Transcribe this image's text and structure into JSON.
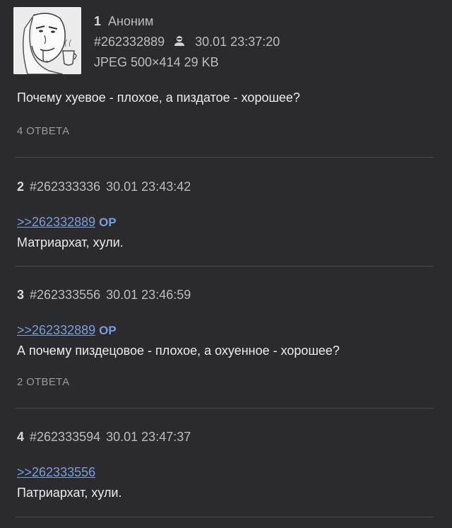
{
  "op": {
    "number": "1",
    "name": "Аноним",
    "post_id": "#262332889",
    "datetime": "30.01 23:37:20",
    "file_info": "JPEG 500×414 29 KB",
    "comment": "Почему хуевое - плохое, а пиздатое - хорошее?",
    "replies": "4 ОТВЕТА"
  },
  "posts": [
    {
      "number": "2",
      "post_id": "#262333336",
      "datetime": "30.01 23:43:42",
      "reply_link": ">>262332889",
      "op_tag": "OP",
      "comment": "Матриархат, хули.",
      "replies": ""
    },
    {
      "number": "3",
      "post_id": "#262333556",
      "datetime": "30.01 23:46:59",
      "reply_link": ">>262332889",
      "op_tag": "OP",
      "comment": "А почему пиздецовое - плохое, а охуенное - хорошее?",
      "replies": "2 ОТВЕТА"
    },
    {
      "number": "4",
      "post_id": "#262333594",
      "datetime": "30.01 23:47:37",
      "reply_link": ">>262333556",
      "op_tag": "",
      "comment": "Патриархат, хули.",
      "replies": ""
    }
  ],
  "colors": {
    "background": "#2b2b2d",
    "link": "#7a9ed8",
    "text": "#e4e4e4",
    "muted": "#9a9a9a"
  }
}
